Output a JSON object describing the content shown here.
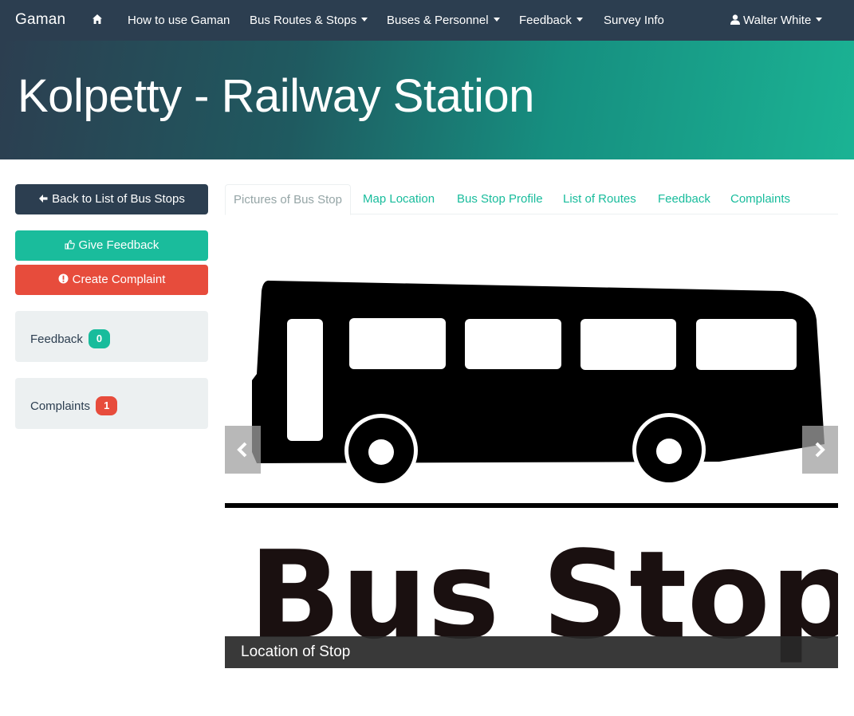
{
  "navbar": {
    "brand": "Gaman",
    "items": [
      {
        "label": "How to use Gaman"
      },
      {
        "label": "Bus Routes & Stops"
      },
      {
        "label": "Buses & Personnel"
      },
      {
        "label": "Feedback"
      },
      {
        "label": "Survey Info"
      }
    ],
    "user": "Walter White"
  },
  "header": {
    "title": "Kolpetty - Railway Station"
  },
  "sidebar": {
    "back_label": "Back to List of Bus Stops",
    "give_feedback_label": "Give Feedback",
    "create_complaint_label": "Create Complaint",
    "feedback": {
      "label": "Feedback",
      "count": "0"
    },
    "complaints": {
      "label": "Complaints",
      "count": "1"
    }
  },
  "tabs": [
    {
      "label": "Pictures of Bus Stop",
      "active": true
    },
    {
      "label": "Map Location"
    },
    {
      "label": "Bus Stop Profile"
    },
    {
      "label": "List of Routes"
    },
    {
      "label": "Feedback"
    },
    {
      "label": "Complaints"
    }
  ],
  "carousel": {
    "sign_text": "Bus Stop",
    "caption": "Location of Stop"
  },
  "colors": {
    "navbar": "#2c3e50",
    "primary": "#18bc9c",
    "danger": "#e74c3c",
    "well": "#ecf0f1"
  }
}
